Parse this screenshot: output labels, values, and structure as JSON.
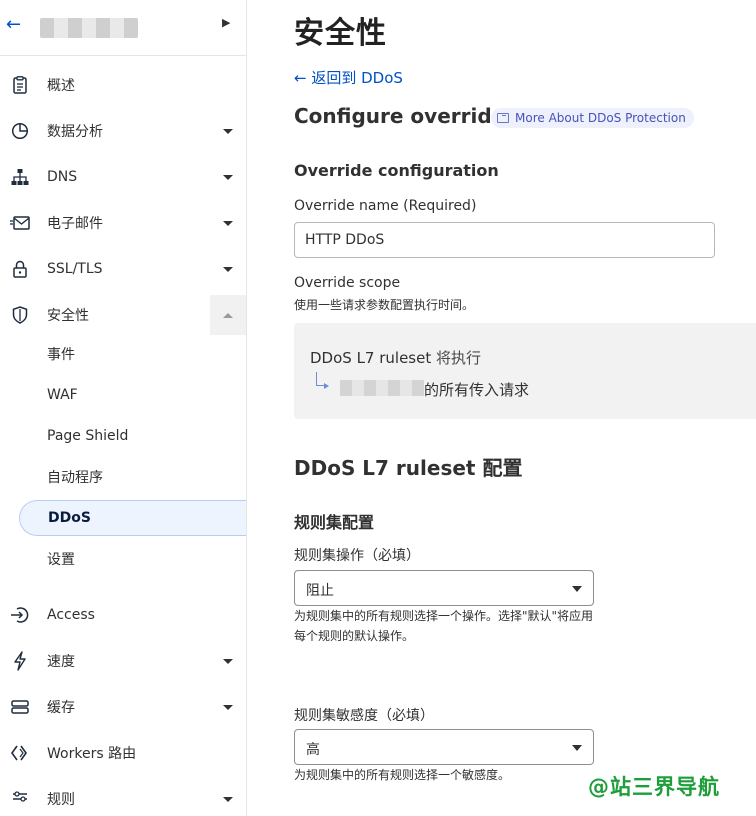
{
  "sidebar": {
    "items": [
      {
        "label": "概述",
        "icon": "clipboard-icon",
        "caret": false
      },
      {
        "label": "数据分析",
        "icon": "pie-chart-icon",
        "caret": true
      },
      {
        "label": "DNS",
        "icon": "sitemap-icon",
        "caret": true
      },
      {
        "label": "电子邮件",
        "icon": "email-icon",
        "caret": true
      },
      {
        "label": "SSL/TLS",
        "icon": "lock-icon",
        "caret": true
      },
      {
        "label": "安全性",
        "icon": "shield-icon",
        "caret": "up"
      }
    ],
    "security_sub": [
      "事件",
      "WAF",
      "Page Shield",
      "自动程序",
      "DDoS",
      "设置"
    ],
    "items_lower": [
      {
        "label": "Access",
        "icon": "access-icon",
        "caret": false
      },
      {
        "label": "速度",
        "icon": "lightning-icon",
        "caret": true
      },
      {
        "label": "缓存",
        "icon": "storage-icon",
        "caret": true
      },
      {
        "label": "Workers 路由",
        "icon": "workers-icon",
        "caret": false
      },
      {
        "label": "规则",
        "icon": "rules-icon",
        "caret": true
      }
    ]
  },
  "main": {
    "page_title": "安全性",
    "back_link": "← 返回到 DDoS",
    "configure_heading": "Configure override",
    "more_badge": "More About DDoS Protection",
    "override_config_heading": "Override configuration",
    "override_name_label": "Override name (Required)",
    "override_name_value": "HTTP DDoS",
    "override_scope_label": "Override scope",
    "override_scope_desc": "使用一些请求参数配置执行时间。",
    "scope_ruleset": "DDoS L7 ruleset",
    "scope_executes": " 将执行",
    "scope_requests": "的所有传入请求",
    "l7_heading": "DDoS L7 ruleset 配置",
    "ruleset_config_heading": "规则集配置",
    "action_label": "规则集操作（必填）",
    "action_value": "阻止",
    "action_help": "为规则集中的所有规则选择一个操作。选择\"默认\"将应用每个规则的默认操作。",
    "sensitivity_label": "规则集敏感度（必填）",
    "sensitivity_value": "高",
    "sensitivity_help": "为规则集中的所有规则选择一个敏感度。"
  },
  "watermark": "@站三界导航",
  "colors": {
    "link": "#0051c3",
    "active_bg": "#eef4fd",
    "watermark": "#1e9e3a"
  }
}
